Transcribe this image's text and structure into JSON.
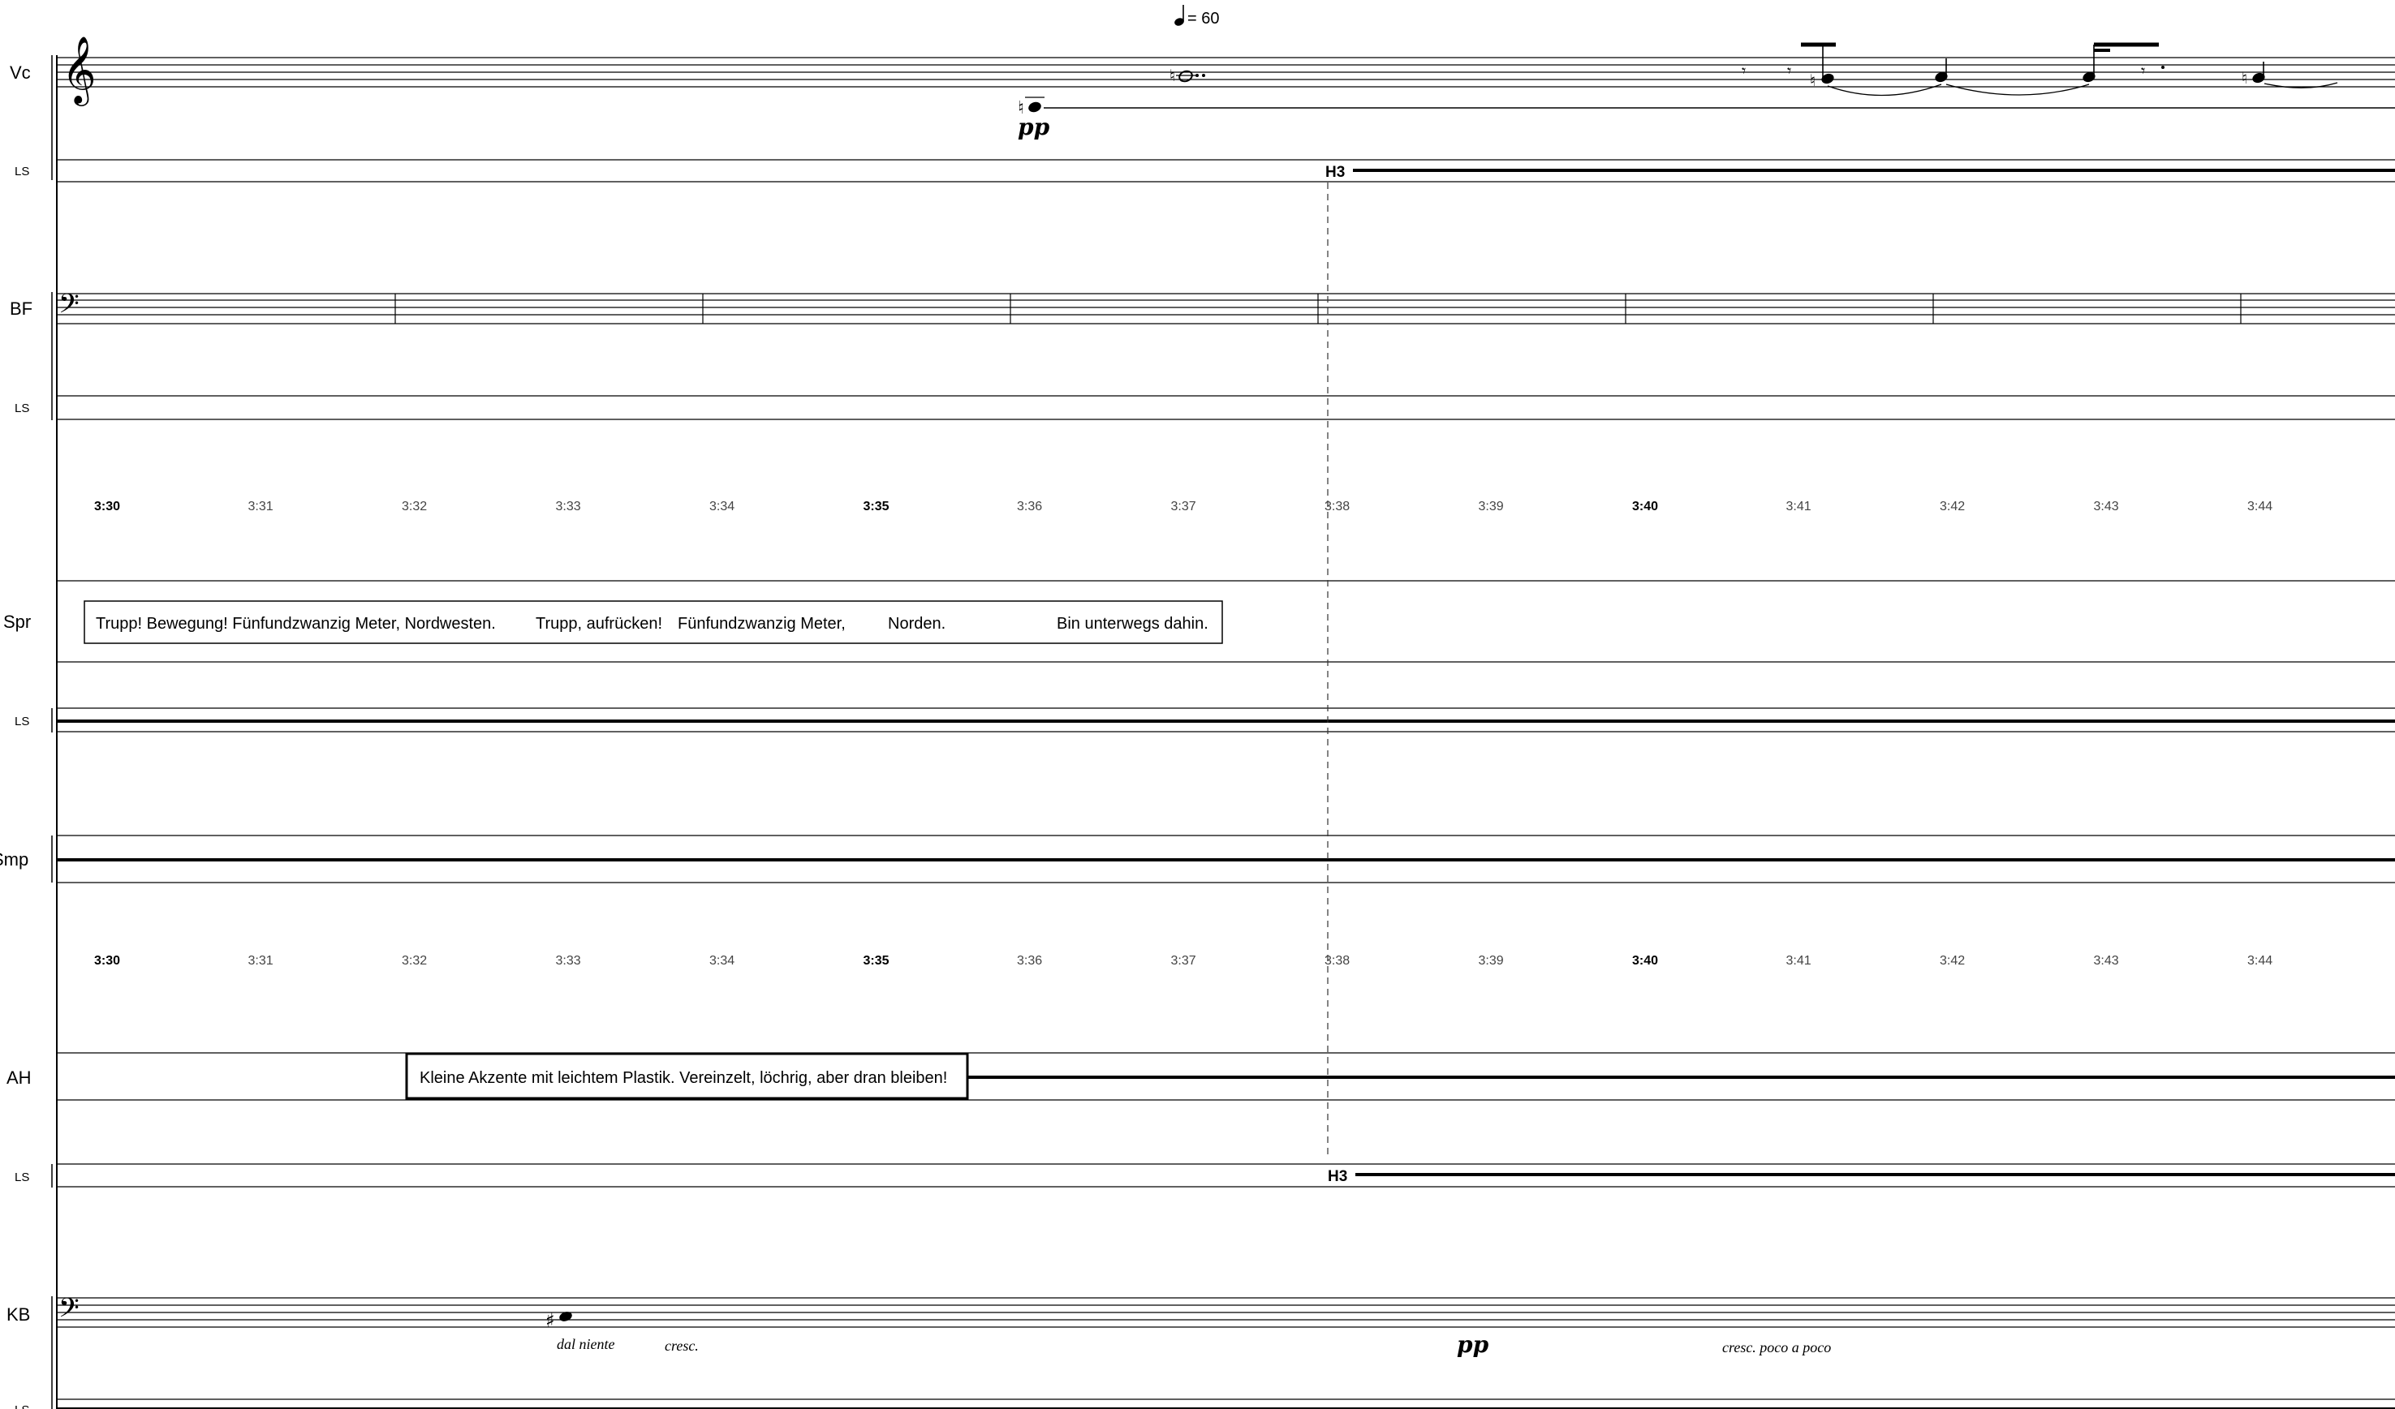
{
  "tempo": {
    "note_icon": "quarter-note-icon",
    "text": "= 60"
  },
  "staves": [
    {
      "id": "vc",
      "label": "Vc"
    },
    {
      "id": "vc-ls",
      "label": "LS"
    },
    {
      "id": "bf",
      "label": "BF"
    },
    {
      "id": "bf-ls",
      "label": "LS"
    },
    {
      "id": "spr",
      "label": "Spr"
    },
    {
      "id": "spr-ls",
      "label": "LS"
    },
    {
      "id": "smp",
      "label": "Smp"
    },
    {
      "id": "ah",
      "label": "AH"
    },
    {
      "id": "ah-ls",
      "label": "LS"
    },
    {
      "id": "kb",
      "label": "KB"
    },
    {
      "id": "kb-ls",
      "label": "LS"
    }
  ],
  "timeline": [
    "3:30",
    "3:31",
    "3:32",
    "3:33",
    "3:34",
    "3:35",
    "3:36",
    "3:37",
    "3:38",
    "3:39",
    "3:40",
    "3:41",
    "3:42",
    "3:43",
    "3:44"
  ],
  "timeline_bold": [
    "3:30",
    "3:35",
    "3:40"
  ],
  "markers": {
    "vc_ls": "H3",
    "ah_ls": "H3"
  },
  "dynamics": {
    "vc": "pp",
    "kb": "pp"
  },
  "expressions": {
    "kb_dal_niente": "dal niente",
    "kb_cresc": "cresc.",
    "kb_cresc_poco": "cresc. poco a poco"
  },
  "spr_box": {
    "phrases": [
      "Trupp! Bewegung! Fünfundzwanzig Meter, Nordwesten.",
      "Trupp, aufrücken!",
      "Fünfundzwanzig Meter,",
      "Norden.",
      "Bin unterwegs dahin."
    ]
  },
  "ah_box": {
    "text": "Kleine Akzente mit leichtem Plastik. Vereinzelt, löchrig, aber dran bleiben!"
  },
  "icons": {
    "clef_treble": "treble-clef-icon",
    "clef_bass": "bass-clef-icon"
  }
}
